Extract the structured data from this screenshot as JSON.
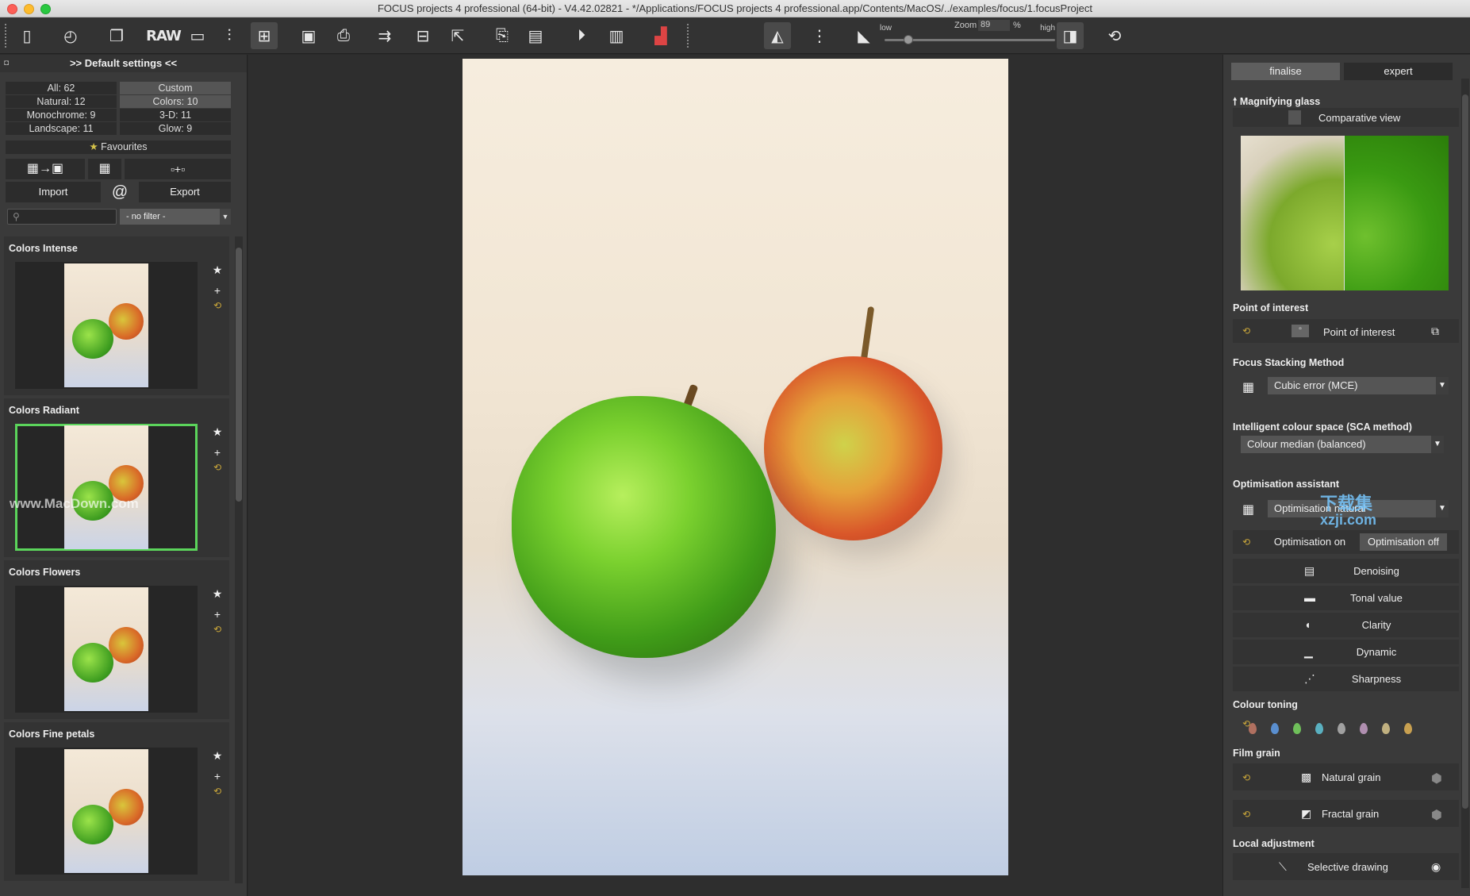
{
  "window": {
    "title": "FOCUS projects 4 professional (64-bit) - V4.42.02821 - */Applications/FOCUS projects 4 professional.app/Contents/MacOS/../examples/focus/1.focusProject"
  },
  "toolbar": {
    "raw_label": "RAW",
    "zoom": {
      "low": "low",
      "high": "high",
      "label": "Zoom",
      "value": "89",
      "unit": "%",
      "position": 0.12
    }
  },
  "left_panel": {
    "header": ">> Default settings <<",
    "counts": [
      {
        "label": "All: 62",
        "selected": false
      },
      {
        "label": "Custom",
        "selected": true
      },
      {
        "label": "Natural: 12",
        "selected": false
      },
      {
        "label": "Colors: 10",
        "selected": true
      },
      {
        "label": "Monochrome: 9",
        "selected": false
      },
      {
        "label": "3-D: 11",
        "selected": false
      },
      {
        "label": "Landscape: 11",
        "selected": false
      },
      {
        "label": "Glow: 9",
        "selected": false
      }
    ],
    "favourites": "Favourites",
    "import_label": "Import",
    "at_label": "@",
    "export_label": "Export",
    "filter_value": "- no filter -",
    "presets": [
      {
        "title": "Colors Intense",
        "selected": false
      },
      {
        "title": "Colors Radiant",
        "selected": true
      },
      {
        "title": "Colors Flowers",
        "selected": false
      },
      {
        "title": "Colors Fine petals",
        "selected": false
      }
    ],
    "watermark": "www.MacDown.com"
  },
  "right_panel": {
    "tabs": {
      "finalise": "finalise",
      "expert": "expert"
    },
    "magnifying_glass": "Magnifying glass",
    "comparative_view": "Comparative view",
    "point_of_interest_section": "Point of interest",
    "point_of_interest_label": "Point of interest",
    "focus_stacking_section": "Focus Stacking Method",
    "focus_stacking_value": "Cubic error (MCE)",
    "sca_section": "Intelligent colour space (SCA method)",
    "sca_value": "Colour median (balanced)",
    "optimisation_section": "Optimisation assistant",
    "optimisation_value": "Optimisation natural",
    "optimisation_on": "Optimisation on",
    "optimisation_off": "Optimisation off",
    "optimisation_items": [
      "Denoising",
      "Tonal value",
      "Clarity",
      "Dynamic",
      "Sharpness"
    ],
    "colour_toning_section": "Colour toning",
    "colour_toning_drops": [
      "#b07060",
      "#5a8fd0",
      "#6fbf5a",
      "#5ab0c0",
      "#a0a0a0",
      "#b08fb0",
      "#c0b080",
      "#c8a050"
    ],
    "film_grain_section": "Film grain",
    "natural_grain": "Natural grain",
    "fractal_grain": "Fractal grain",
    "local_adjustment_section": "Local adjustment",
    "selective_drawing": "Selective drawing",
    "logo_watermark_1": "下载集",
    "logo_watermark_2": "xzji.com"
  }
}
